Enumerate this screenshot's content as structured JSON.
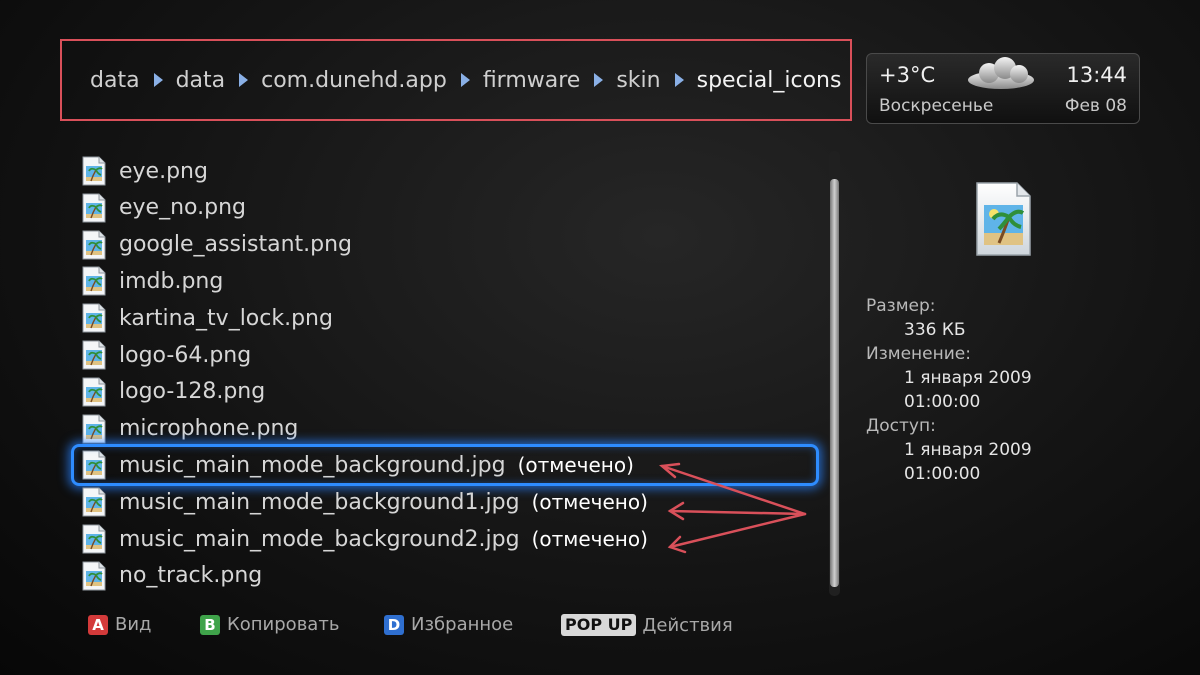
{
  "breadcrumb": [
    "data",
    "data",
    "com.dunehd.app",
    "firmware",
    "skin",
    "special_icons"
  ],
  "weather": {
    "temperature": "+3°C",
    "day": "Воскресенье",
    "time": "13:44",
    "date": "Фев 08"
  },
  "files": [
    {
      "name": "eye.png",
      "marked": false
    },
    {
      "name": "eye_no.png",
      "marked": false
    },
    {
      "name": "google_assistant.png",
      "marked": false
    },
    {
      "name": "imdb.png",
      "marked": false
    },
    {
      "name": "kartina_tv_lock.png",
      "marked": false
    },
    {
      "name": "logo-64.png",
      "marked": false
    },
    {
      "name": "logo-128.png",
      "marked": false
    },
    {
      "name": "microphone.png",
      "marked": false
    },
    {
      "name": "music_main_mode_background.jpg",
      "marked": true,
      "selected": true
    },
    {
      "name": "music_main_mode_background1.jpg",
      "marked": true
    },
    {
      "name": "music_main_mode_background2.jpg",
      "marked": true
    },
    {
      "name": "no_track.png",
      "marked": false
    }
  ],
  "marked_label": "(отмечено)",
  "info": {
    "size_label": "Размер:",
    "size_value": "336 КБ",
    "modified_label": "Изменение:",
    "modified_date": "1 января 2009",
    "modified_time": "01:00:00",
    "access_label": "Доступ:",
    "access_date": "1 января 2009",
    "access_time": "01:00:00"
  },
  "hints": [
    {
      "key": "A",
      "label": "Вид",
      "color": "#d33a3a"
    },
    {
      "key": "B",
      "label": "Копировать",
      "color": "#3fa34a"
    },
    {
      "key": "D",
      "label": "Избранное",
      "color": "#2f6fd0"
    },
    {
      "key": "POP UP",
      "label": "Действия"
    }
  ],
  "colors": {
    "selection": "#2e8cff",
    "annotation": "#d9505a"
  }
}
